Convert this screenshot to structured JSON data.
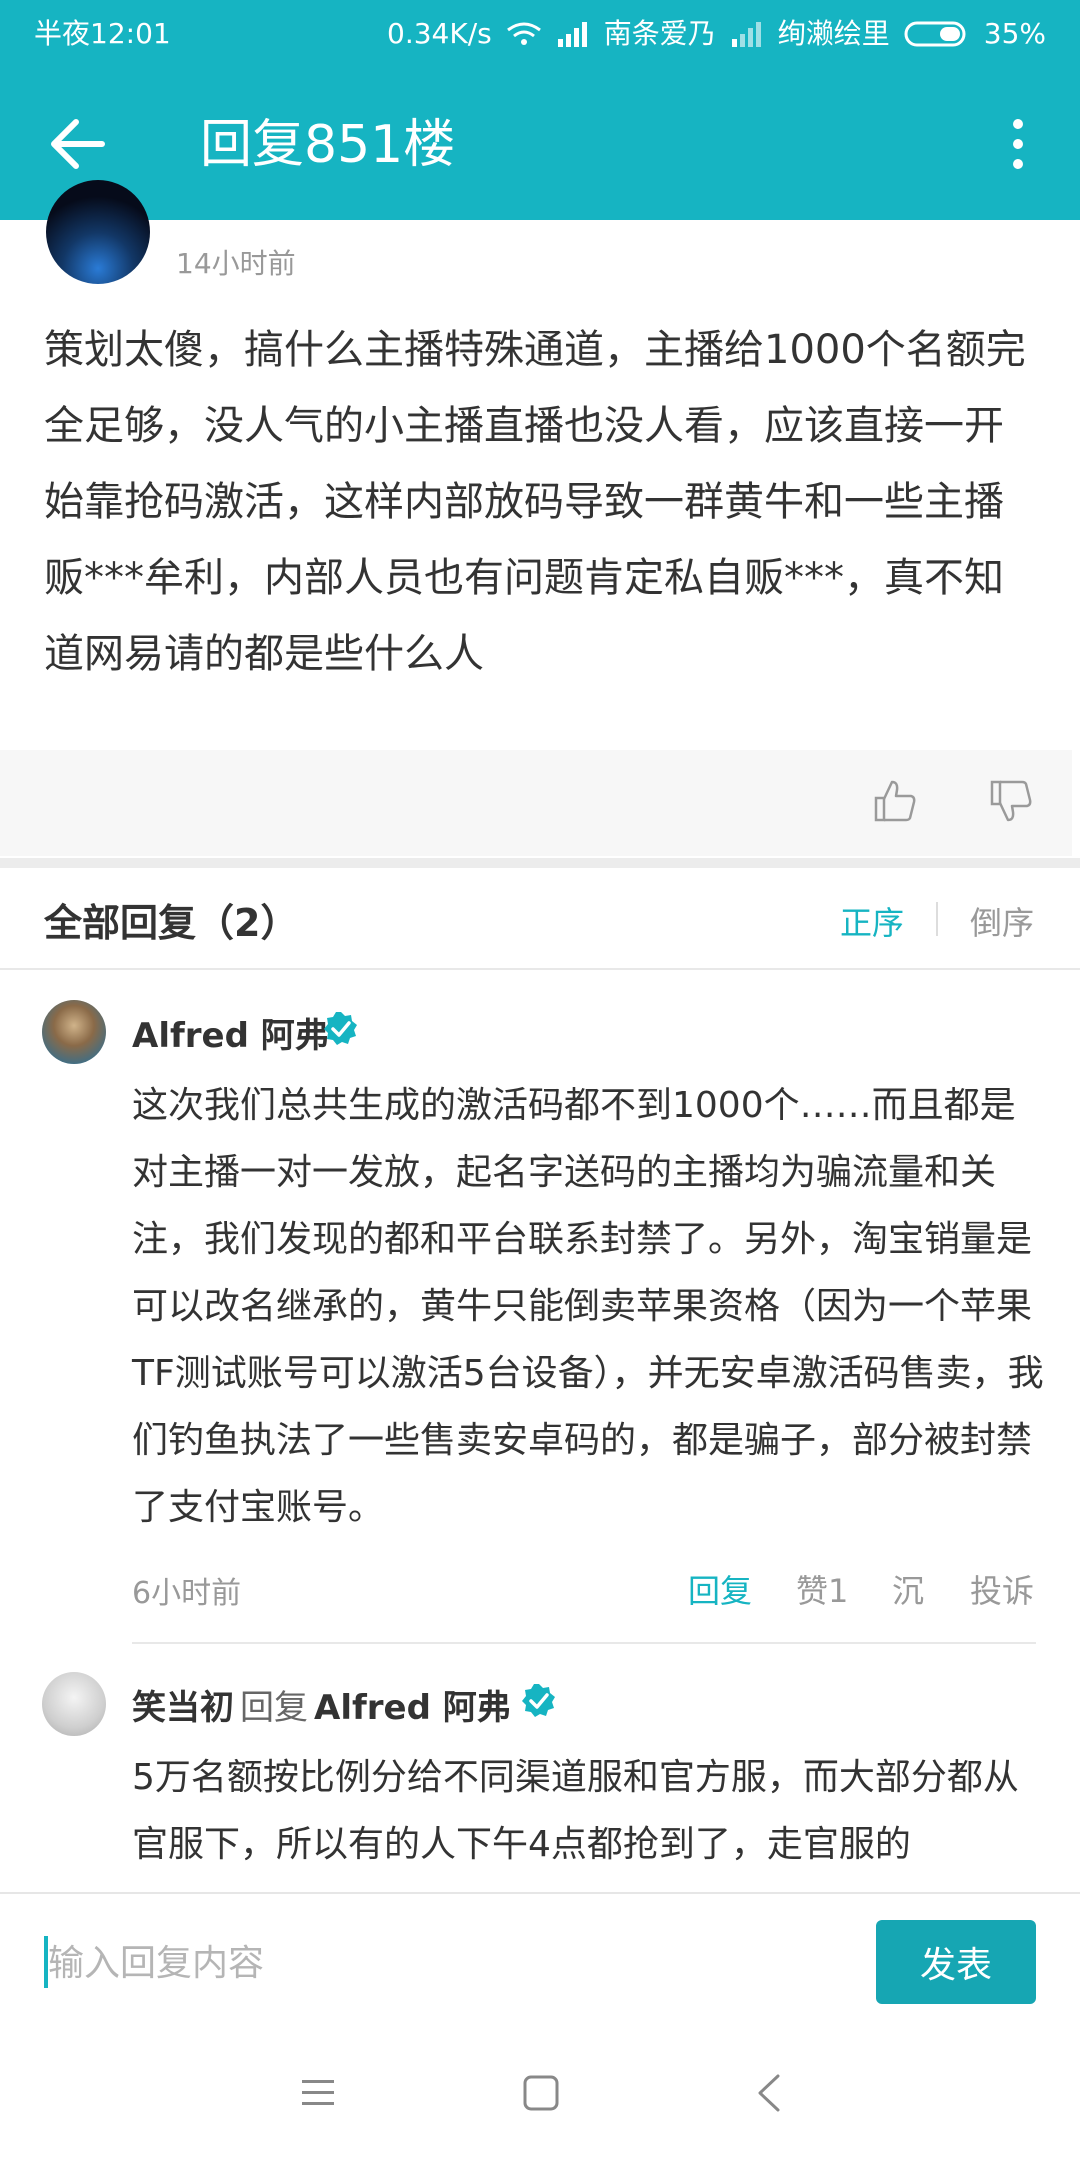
{
  "status_bar": {
    "time": "半夜12:01",
    "speed": "0.34K/s",
    "carrier1": "南条爱乃",
    "carrier2": "绚濑绘里",
    "battery": "35%"
  },
  "app_bar": {
    "title": "回复851楼"
  },
  "post": {
    "time": "14小时前",
    "body": "策划太傻，搞什么主播特殊通道，主播给1000个名额完全足够，没人气的小主播直播也没人看，应该直接一开始靠抢码激活，这样内部放码导致一群黄牛和一些主播贩***牟利，内部人员也有问题肯定私自贩***，真不知道网易请的都是些什么人"
  },
  "replies_header": {
    "title": "全部回复（2）",
    "sort_asc": "正序",
    "sort_desc": "倒序"
  },
  "replies": [
    {
      "author": "Alfred 阿弗",
      "body": "这次我们总共生成的激活码都不到1000个……而且都是对主播一对一发放，起名字送码的主播均为骗流量和关注，我们发现的都和平台联系封禁了。另外，淘宝销量是可以改名继承的，黄牛只能倒卖苹果资格（因为一个苹果TF测试账号可以激活5台设备），并无安卓激活码售卖，我们钓鱼执法了一些售卖安卓码的，都是骗子，部分被封禁了支付宝账号。",
      "time": "6小时前",
      "reply_label": "回复",
      "like_label": "赞1",
      "sink_label": "沉",
      "report_label": "投诉"
    },
    {
      "author": "笑当初",
      "verb": "回复",
      "target": "Alfred 阿弗",
      "body": "5万名额按比例分给不同渠道服和官方服，而大部分都从官服下，所以有的人下午4点都抢到了，走官服的"
    }
  ],
  "input_bar": {
    "placeholder": "输入回复内容",
    "submit_label": "发表"
  },
  "colors": {
    "accent": "#16b4c2",
    "button": "#16a6b3"
  },
  "icons": {
    "back": "arrow-left-icon",
    "more": "more-vertical-icon",
    "like": "thumbs-up-icon",
    "dislike": "thumbs-down-icon",
    "verified": "verified-badge-icon"
  }
}
